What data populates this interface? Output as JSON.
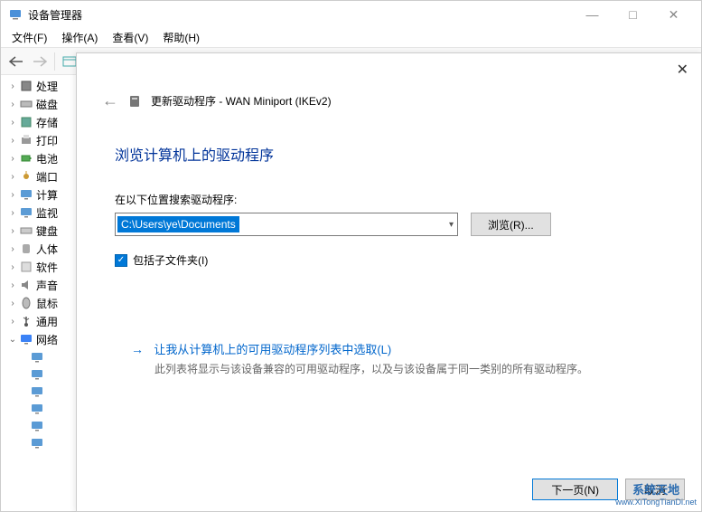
{
  "window": {
    "title": "设备管理器",
    "minimize": "—",
    "maximize": "□",
    "close": "✕"
  },
  "menu": {
    "file": "文件(F)",
    "action": "操作(A)",
    "view": "查看(V)",
    "help": "帮助(H)"
  },
  "tree": {
    "items": [
      {
        "label": "处理",
        "icon": "cpu"
      },
      {
        "label": "磁盘",
        "icon": "disk"
      },
      {
        "label": "存储",
        "icon": "storage"
      },
      {
        "label": "打印",
        "icon": "printer"
      },
      {
        "label": "电池",
        "icon": "battery"
      },
      {
        "label": "端口",
        "icon": "port"
      },
      {
        "label": "计算",
        "icon": "computer"
      },
      {
        "label": "监视",
        "icon": "monitor"
      },
      {
        "label": "键盘",
        "icon": "keyboard"
      },
      {
        "label": "人体",
        "icon": "hid"
      },
      {
        "label": "软件",
        "icon": "software"
      },
      {
        "label": "声音",
        "icon": "audio"
      },
      {
        "label": "鼠标",
        "icon": "mouse"
      },
      {
        "label": "通用",
        "icon": "usb"
      }
    ],
    "expanded": {
      "label": "网络",
      "icon": "network"
    },
    "child_count": 6
  },
  "dialog": {
    "crumb": "更新驱动程序 - WAN Miniport (IKEv2)",
    "heading": "浏览计算机上的驱动程序",
    "search_label": "在以下位置搜索驱动程序:",
    "path_value": "C:\\Users\\ye\\Documents",
    "browse": "浏览(R)...",
    "include_sub": "包括子文件夹(I)",
    "choice_title": "让我从计算机上的可用驱动程序列表中选取(L)",
    "choice_desc": "此列表将显示与该设备兼容的可用驱动程序，以及与该设备属于同一类别的所有驱动程序。",
    "next": "下一页(N)",
    "cancel": "取消"
  },
  "watermark": {
    "title": "系统天地",
    "url": "www.XiTongTianDi.net"
  }
}
